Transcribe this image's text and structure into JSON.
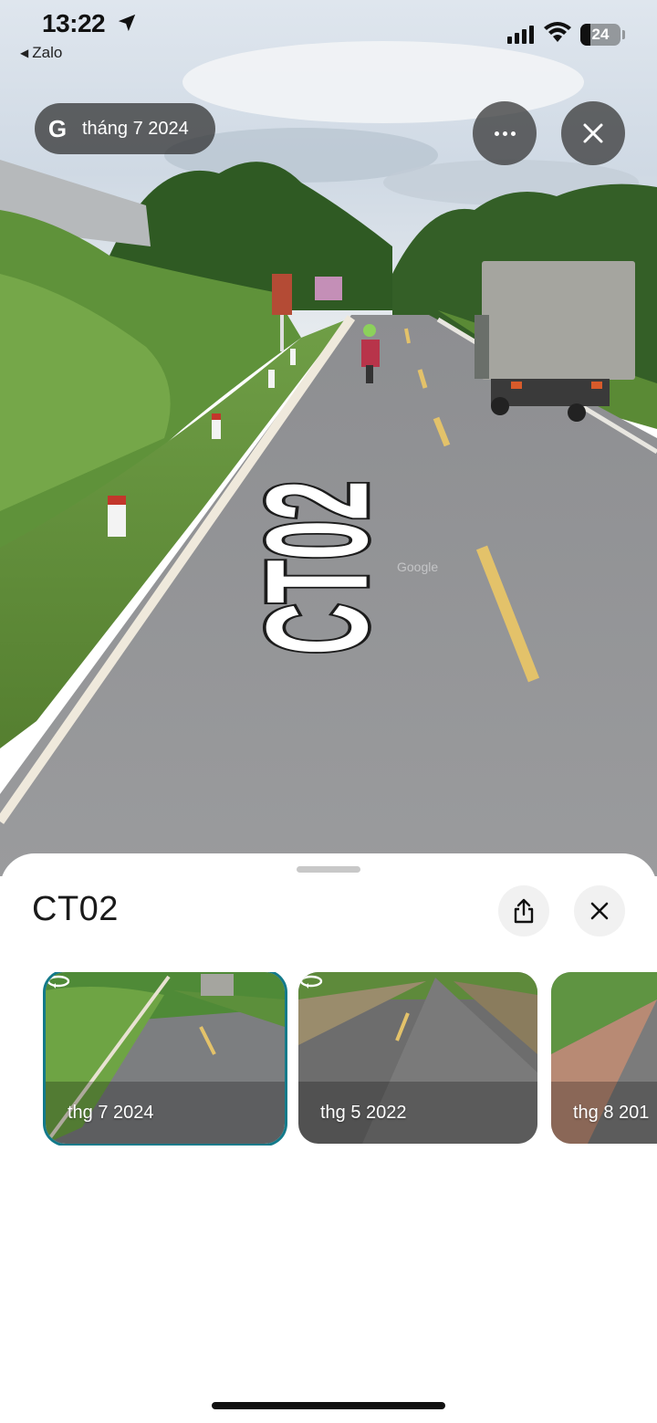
{
  "status_bar": {
    "time": "13:22",
    "back_app": "Zalo",
    "battery": "24",
    "battery_level": 0.24
  },
  "viewer": {
    "date_chip": "tháng 7 2024",
    "road_marking": "CT02",
    "watermark": "Google",
    "icons": {
      "brand": "google-g-icon",
      "more": "more-horizontal-icon",
      "close": "close-icon"
    }
  },
  "sheet": {
    "title": "CT02",
    "icons": {
      "share": "share-icon",
      "close": "close-icon",
      "rotate": "rotate-360-icon"
    },
    "thumbnails": [
      {
        "label": "thg 7 2024",
        "selected": true
      },
      {
        "label": "thg 5 2022",
        "selected": false
      },
      {
        "label": "thg 8 201",
        "selected": false
      }
    ]
  },
  "colors": {
    "selected_border": "#137a8a",
    "chip_bg": "#2d2d2d",
    "sheet_bg": "#ffffff"
  }
}
